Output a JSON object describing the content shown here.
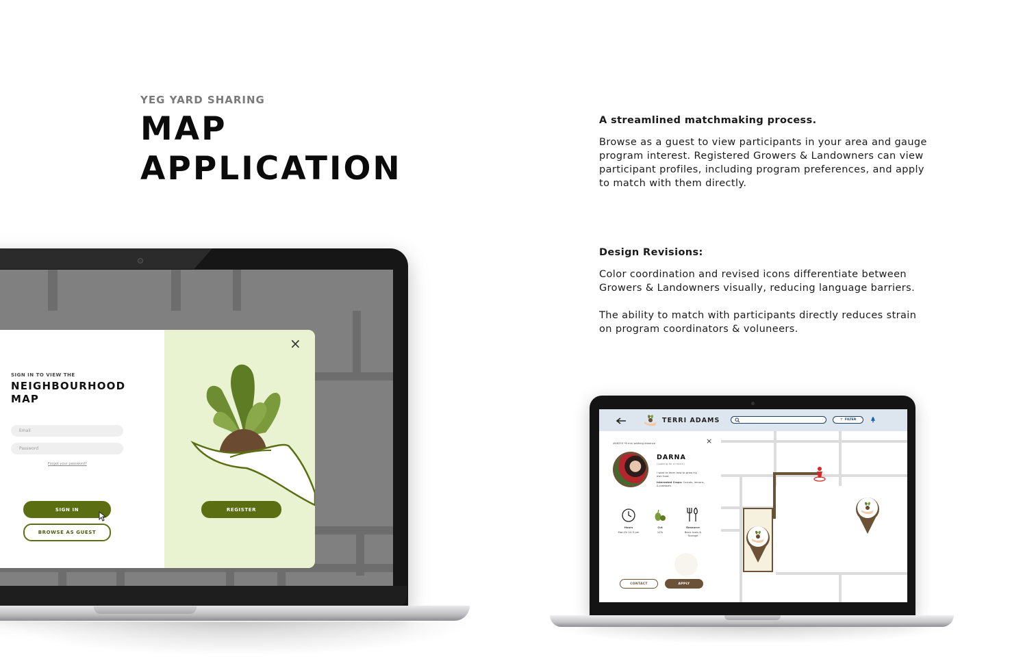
{
  "header": {
    "eyebrow": "YEG YARD SHARING",
    "title_line1": "MAP",
    "title_line2": "APPLICATION"
  },
  "description": {
    "heading": "A streamlined matchmaking process.",
    "body": "Browse as a guest to view participants in your area and gauge program interest. Registered Growers & Landowners can view participant profiles, including program preferences, and apply to match with them directly."
  },
  "revisions": {
    "heading": "Design Revisions:",
    "para1": "Color coordination and revised icons differentiate between Growers & Landowners visually, reducing language barriers.",
    "para2": "The ability to match with participants directly reduces strain on program coordinators & voluneers."
  },
  "signin_modal": {
    "subtitle": "SIGN IN TO VIEW THE",
    "title_line1": "NEIGHBOURHOOD",
    "title_line2": "MAP",
    "email_placeholder": "Email",
    "password_placeholder": "Password",
    "forgot_link": "Forgot your password?",
    "signin_label": "SIGN IN",
    "guest_label": "BROWSE AS GUEST",
    "register_label": "REGISTER",
    "close_icon": "×"
  },
  "profile_screen": {
    "user_name": "TERRI ADAMS",
    "filter_label": "FILTER",
    "distance_text": "#48253 *6 min walking distance",
    "participant_name": "DARNA",
    "status": "(Looking for a match)",
    "bio": "I want to learn how to grow my own food.",
    "interested_label": "Interested Crops:",
    "interested_value": "Carrots, lemons, & potatoes.",
    "stats": [
      {
        "icon": "clock-icon",
        "label": "Hours",
        "value": "Mon-Fri 10-5 pm"
      },
      {
        "icon": "produce-icon",
        "label": "Cut",
        "value": "10%"
      },
      {
        "icon": "tools-icon",
        "label": "Resource",
        "value": "Basic tools & Storage"
      }
    ],
    "contact_label": "CONTACT",
    "apply_label": "APPLY"
  },
  "colors": {
    "olive": "#5b6f12",
    "light_green": "#e9f3d2",
    "brown": "#6b5236",
    "navy": "#1d3d66",
    "map_gray": "#808080"
  }
}
